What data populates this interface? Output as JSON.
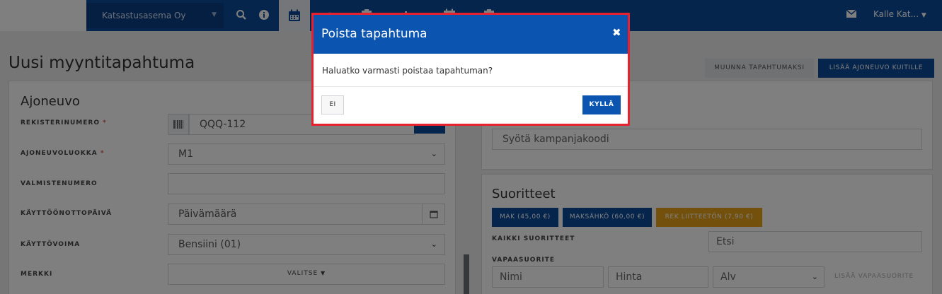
{
  "topbar": {
    "station": "Katsastusasema Oy",
    "user": "Kalle Kat...",
    "icons": [
      "search-icon",
      "info-icon",
      "calendar-icon",
      "speedometer-icon",
      "clipboard-icon",
      "chart-icon",
      "calendar-icon",
      "clipboard-icon",
      "mail-icon"
    ]
  },
  "page": {
    "title": "Uusi myyntitapahtuma",
    "convert_button": "MUUNNA TAPAHTUMAKSI",
    "add_vehicle_button": "LISÄÄ AJONEUVO KUITILLE"
  },
  "vehicle": {
    "heading": "Ajoneuvo",
    "reg_label": "REKISTERINUMERO",
    "reg_value": "QQQ-112",
    "class_label": "AJONEUVOLUOKKA",
    "class_value": "M1",
    "vin_label": "VALMISTENUMERO",
    "vin_value": "",
    "date_label": "KÄYTTÖÖNOTTOPÄIVÄ",
    "date_placeholder": "Päivämäärä",
    "fuel_label": "KÄYTTÖVOIMA",
    "fuel_value": "Bensiini (01)",
    "brand_label": "MERKKI",
    "brand_value": "VALITSE",
    "required_mark": "*"
  },
  "campaign": {
    "placeholder": "Syötä kampanjakoodi"
  },
  "services": {
    "heading": "Suoritteet",
    "chips": [
      {
        "label": "MAK (45,00 €)",
        "color": "#0b4a9a"
      },
      {
        "label": "MAKSÄHKÖ (60,00 €)",
        "color": "#0b4a9a"
      },
      {
        "label": "REK LIITTEETÖN (7,90 €)",
        "color": "#e7a21a"
      }
    ],
    "all_label": "KAIKKI SUORITTEET",
    "search_placeholder": "Etsi",
    "free_label": "VAPAASUORITE",
    "name_placeholder": "Nimi",
    "price_placeholder": "Hinta",
    "vat_value": "Alv",
    "add_free_button": "LISÄÄ VAPAASUORITE"
  },
  "modal": {
    "title": "Poista tapahtuma",
    "body": "Haluatko varmasti poistaa tapahtuman?",
    "cancel_label": "EI",
    "confirm_label": "KYLLÄ",
    "close_glyph": "✖",
    "border_color": "#e8212e",
    "header_color": "#0b55b1"
  }
}
